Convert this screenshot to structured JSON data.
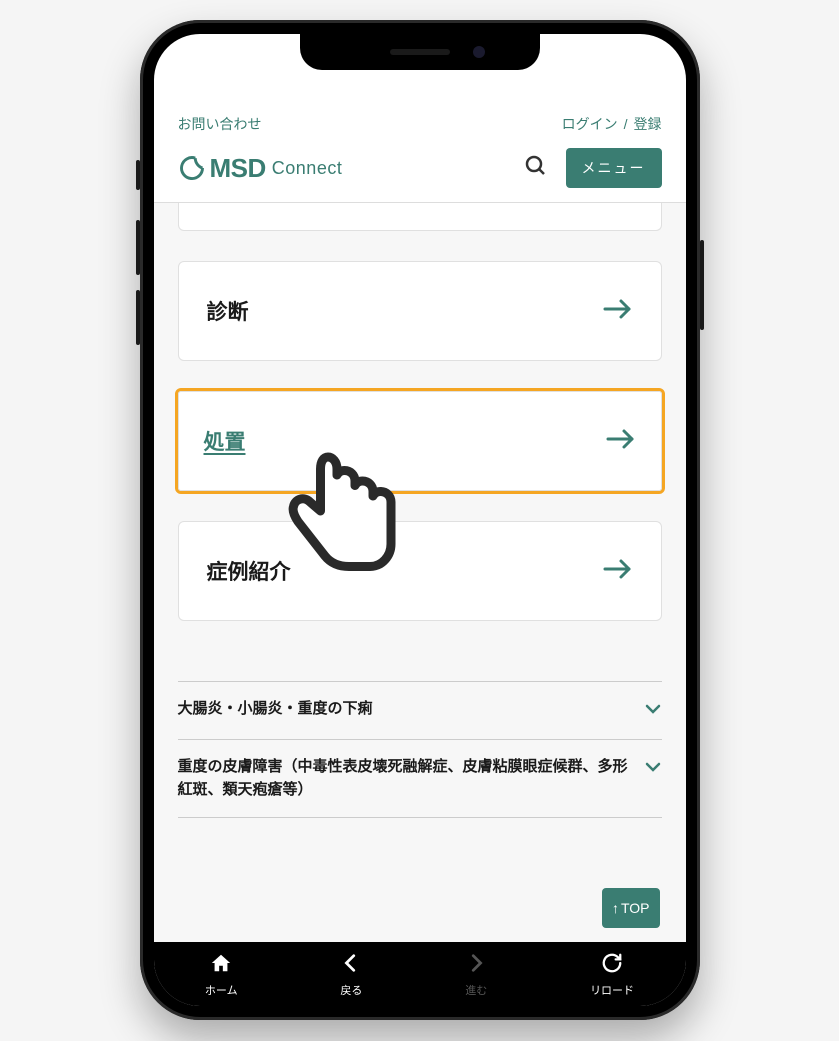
{
  "topLinks": {
    "contact": "お問い合わせ",
    "login": "ログイン",
    "separator": "/",
    "register": "登録"
  },
  "logo": {
    "msd": "MSD",
    "connect": "Connect"
  },
  "menuButton": "メニュー",
  "cards": {
    "diagnosis": "診断",
    "treatment": "処置",
    "caseIntro": "症例紹介"
  },
  "listItems": {
    "item1": "大腸炎・小腸炎・重度の下痢",
    "item2": "重度の皮膚障害（中毒性表皮壊死融解症、皮膚粘膜眼症候群、多形紅斑、類天疱瘡等）"
  },
  "topButton": "TOP",
  "bottomNav": {
    "home": "ホーム",
    "back": "戻る",
    "forward": "進む",
    "reload": "リロード"
  }
}
